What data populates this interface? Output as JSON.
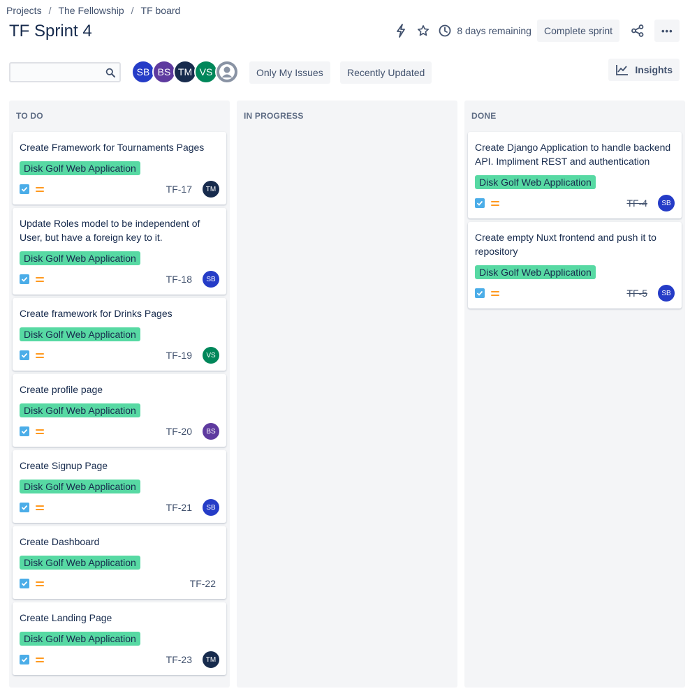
{
  "breadcrumbs": [
    "Projects",
    "The Fellowship",
    "TF board"
  ],
  "breadcrumb_separator": "/",
  "title": "TF Sprint 4",
  "header": {
    "automation_icon": "lightning-icon",
    "star_icon": "star-icon",
    "remaining_icon": "clock-icon",
    "remaining_text": "8 days remaining",
    "complete_label": "Complete sprint",
    "share_icon": "share-icon",
    "more_label": "•••"
  },
  "search": {
    "value": "",
    "placeholder": "",
    "icon": "search-icon"
  },
  "users": [
    {
      "initials": "SB",
      "color": "#253cc7"
    },
    {
      "initials": "BS",
      "color": "#5e3a9f"
    },
    {
      "initials": "TM",
      "color": "#172b4d"
    },
    {
      "initials": "VS",
      "color": "#00875a"
    },
    {
      "initials": "",
      "color": "#8993a4",
      "icon": "user-placeholder-icon"
    }
  ],
  "filters": {
    "only_my_issues": "Only My Issues",
    "recently_updated": "Recently Updated"
  },
  "insights_label": "Insights",
  "colors": {
    "epic": "#57d9a3",
    "story_check": "#4bade8",
    "priority_medium": "#ff991f"
  },
  "columns": [
    {
      "title": "TO DO",
      "cards": [
        {
          "summary": "Create Framework for Tournaments Pages",
          "epic": "Disk Golf Web Application",
          "key": "TF-17",
          "avatar": "TM",
          "avatar_color": "#172b4d"
        },
        {
          "summary": "Update Roles model to be independent of User, but have a foreign key to it.",
          "epic": "Disk Golf Web Application",
          "key": "TF-18",
          "avatar": "SB",
          "avatar_color": "#253cc7"
        },
        {
          "summary": "Create framework for Drinks Pages",
          "epic": "Disk Golf Web Application",
          "key": "TF-19",
          "avatar": "VS",
          "avatar_color": "#00875a"
        },
        {
          "summary": "Create profile page",
          "epic": "Disk Golf Web Application",
          "key": "TF-20",
          "avatar": "BS",
          "avatar_color": "#5e3a9f"
        },
        {
          "summary": "Create Signup Page",
          "epic": "Disk Golf Web Application",
          "key": "TF-21",
          "avatar": "SB",
          "avatar_color": "#253cc7"
        },
        {
          "summary": "Create Dashboard",
          "epic": "Disk Golf Web Application",
          "key": "TF-22",
          "avatar": "",
          "avatar_color": ""
        },
        {
          "summary": "Create Landing Page",
          "epic": "Disk Golf Web Application",
          "key": "TF-23",
          "avatar": "TM",
          "avatar_color": "#172b4d"
        }
      ]
    },
    {
      "title": "IN PROGRESS",
      "cards": []
    },
    {
      "title": "DONE",
      "cards": [
        {
          "summary": "Create Django Application to handle backend API. Impliment REST and authentication",
          "epic": "Disk Golf Web Application",
          "key": "TF-4",
          "avatar": "SB",
          "avatar_color": "#253cc7",
          "done": true
        },
        {
          "summary": "Create empty Nuxt frontend and push it to repository",
          "epic": "Disk Golf Web Application",
          "key": "TF-5",
          "avatar": "SB",
          "avatar_color": "#253cc7",
          "done": true
        }
      ]
    }
  ]
}
